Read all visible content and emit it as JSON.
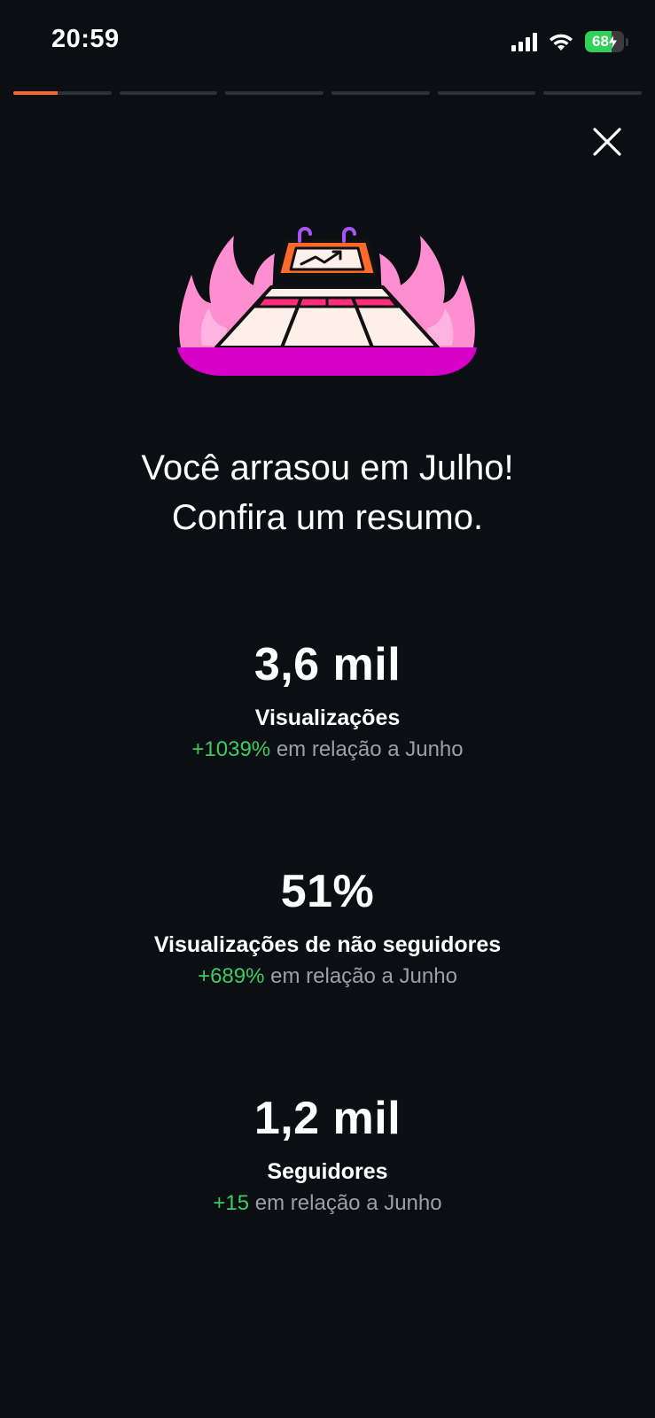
{
  "status_bar": {
    "time": "20:59",
    "battery": "68",
    "battery_level": 0.68,
    "icons": [
      "cellular-signal-icon",
      "wifi-icon",
      "battery-charging-icon"
    ]
  },
  "story_progress": {
    "segments": 6,
    "active_index": 0,
    "active_fill": 0.45,
    "accent_color": "#ff6a2b"
  },
  "close_icon": "close-icon",
  "illustration_icon": "trophy-podium-flames-icon",
  "headline": {
    "line1": "Você arrasou em Julho!",
    "line2": "Confira um resumo."
  },
  "stats": [
    {
      "value": "3,6 mil",
      "label": "Visualizações",
      "delta": "+1039%",
      "comparison": "em relação a Junho"
    },
    {
      "value": "51%",
      "label": "Visualizações de não seguidores",
      "delta": "+689%",
      "comparison": "em relação a Junho"
    },
    {
      "value": "1,2 mil",
      "label": "Seguidores",
      "delta": "+15",
      "comparison": "em relação a Junho"
    }
  ],
  "colors": {
    "background": "#0b0f14",
    "positive": "#3ccb5f",
    "muted_text": "#9aa0a6"
  }
}
